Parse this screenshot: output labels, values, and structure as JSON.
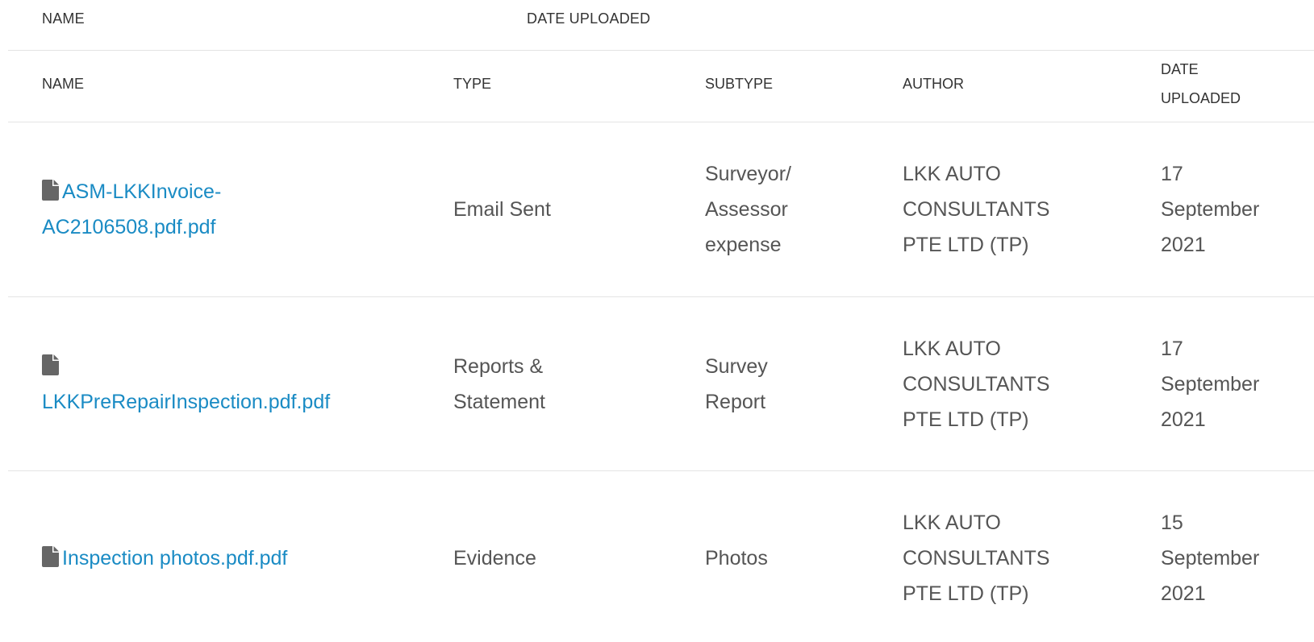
{
  "top_header": {
    "name_label": "NAME",
    "date_uploaded_label": "DATE UPLOADED"
  },
  "table": {
    "columns": {
      "name": "NAME",
      "type": "TYPE",
      "subtype": "SUBTYPE",
      "author": "AUTHOR",
      "date_uploaded_line1": "DATE",
      "date_uploaded_line2": "UPLOADED"
    },
    "rows": [
      {
        "file_icon": "file-icon",
        "name_line1": "ASM-LKKInvoice-",
        "name_line2": "AC2106508.pdf.pdf",
        "type_line1": "Email Sent",
        "subtype_line1": "Surveyor/",
        "subtype_line2": "Assessor",
        "subtype_line3": "expense",
        "author_line1": "LKK AUTO",
        "author_line2": "CONSULTANTS",
        "author_line3": "PTE LTD (TP)",
        "date_line1": "17",
        "date_line2": "September",
        "date_line3": "2021"
      },
      {
        "file_icon": "file-icon",
        "name_line1": "LKKPreRepairInspection.pdf.pdf",
        "type_line1": "Reports &",
        "type_line2": "Statement",
        "subtype_line1": "Survey",
        "subtype_line2": "Report",
        "author_line1": "LKK AUTO",
        "author_line2": "CONSULTANTS",
        "author_line3": "PTE LTD (TP)",
        "date_line1": "17",
        "date_line2": "September",
        "date_line3": "2021"
      },
      {
        "file_icon": "file-icon",
        "name_line1": "Inspection photos.pdf.pdf",
        "type_line1": "Evidence",
        "subtype_line1": "Photos",
        "author_line1": "LKK AUTO",
        "author_line2": "CONSULTANTS",
        "author_line3": "PTE LTD (TP)",
        "date_line1": "15",
        "date_line2": "September",
        "date_line3": "2021"
      }
    ]
  },
  "colors": {
    "link": "#1a8bc4",
    "text": "#555555",
    "header_text": "#333333",
    "divider": "#e4e4e4",
    "icon": "#666666"
  }
}
